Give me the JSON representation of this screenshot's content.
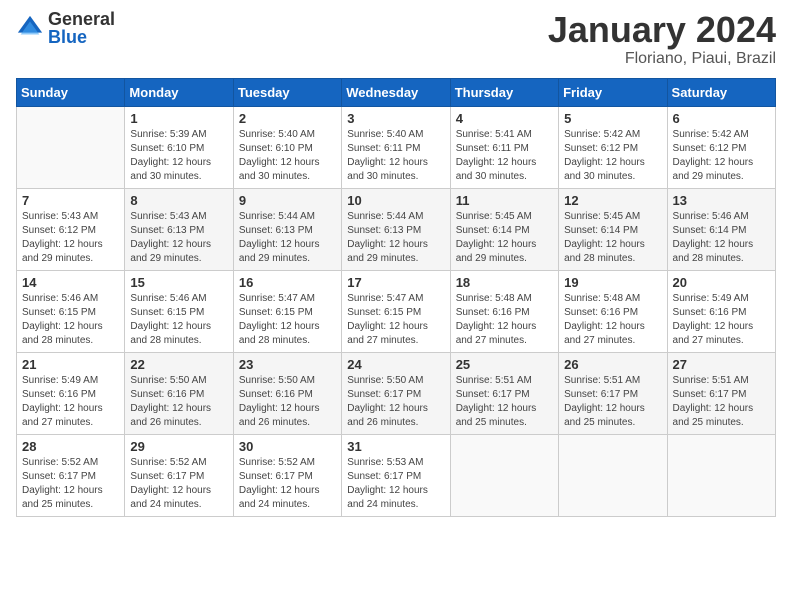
{
  "logo": {
    "general": "General",
    "blue": "Blue"
  },
  "title": {
    "month": "January 2024",
    "location": "Floriano, Piaui, Brazil"
  },
  "weekdays": [
    "Sunday",
    "Monday",
    "Tuesday",
    "Wednesday",
    "Thursday",
    "Friday",
    "Saturday"
  ],
  "weeks": [
    [
      {
        "day": "",
        "sunrise": "",
        "sunset": "",
        "daylight": ""
      },
      {
        "day": "1",
        "sunrise": "Sunrise: 5:39 AM",
        "sunset": "Sunset: 6:10 PM",
        "daylight": "Daylight: 12 hours and 30 minutes."
      },
      {
        "day": "2",
        "sunrise": "Sunrise: 5:40 AM",
        "sunset": "Sunset: 6:10 PM",
        "daylight": "Daylight: 12 hours and 30 minutes."
      },
      {
        "day": "3",
        "sunrise": "Sunrise: 5:40 AM",
        "sunset": "Sunset: 6:11 PM",
        "daylight": "Daylight: 12 hours and 30 minutes."
      },
      {
        "day": "4",
        "sunrise": "Sunrise: 5:41 AM",
        "sunset": "Sunset: 6:11 PM",
        "daylight": "Daylight: 12 hours and 30 minutes."
      },
      {
        "day": "5",
        "sunrise": "Sunrise: 5:42 AM",
        "sunset": "Sunset: 6:12 PM",
        "daylight": "Daylight: 12 hours and 30 minutes."
      },
      {
        "day": "6",
        "sunrise": "Sunrise: 5:42 AM",
        "sunset": "Sunset: 6:12 PM",
        "daylight": "Daylight: 12 hours and 29 minutes."
      }
    ],
    [
      {
        "day": "7",
        "sunrise": "Sunrise: 5:43 AM",
        "sunset": "Sunset: 6:12 PM",
        "daylight": "Daylight: 12 hours and 29 minutes."
      },
      {
        "day": "8",
        "sunrise": "Sunrise: 5:43 AM",
        "sunset": "Sunset: 6:13 PM",
        "daylight": "Daylight: 12 hours and 29 minutes."
      },
      {
        "day": "9",
        "sunrise": "Sunrise: 5:44 AM",
        "sunset": "Sunset: 6:13 PM",
        "daylight": "Daylight: 12 hours and 29 minutes."
      },
      {
        "day": "10",
        "sunrise": "Sunrise: 5:44 AM",
        "sunset": "Sunset: 6:13 PM",
        "daylight": "Daylight: 12 hours and 29 minutes."
      },
      {
        "day": "11",
        "sunrise": "Sunrise: 5:45 AM",
        "sunset": "Sunset: 6:14 PM",
        "daylight": "Daylight: 12 hours and 29 minutes."
      },
      {
        "day": "12",
        "sunrise": "Sunrise: 5:45 AM",
        "sunset": "Sunset: 6:14 PM",
        "daylight": "Daylight: 12 hours and 28 minutes."
      },
      {
        "day": "13",
        "sunrise": "Sunrise: 5:46 AM",
        "sunset": "Sunset: 6:14 PM",
        "daylight": "Daylight: 12 hours and 28 minutes."
      }
    ],
    [
      {
        "day": "14",
        "sunrise": "Sunrise: 5:46 AM",
        "sunset": "Sunset: 6:15 PM",
        "daylight": "Daylight: 12 hours and 28 minutes."
      },
      {
        "day": "15",
        "sunrise": "Sunrise: 5:46 AM",
        "sunset": "Sunset: 6:15 PM",
        "daylight": "Daylight: 12 hours and 28 minutes."
      },
      {
        "day": "16",
        "sunrise": "Sunrise: 5:47 AM",
        "sunset": "Sunset: 6:15 PM",
        "daylight": "Daylight: 12 hours and 28 minutes."
      },
      {
        "day": "17",
        "sunrise": "Sunrise: 5:47 AM",
        "sunset": "Sunset: 6:15 PM",
        "daylight": "Daylight: 12 hours and 27 minutes."
      },
      {
        "day": "18",
        "sunrise": "Sunrise: 5:48 AM",
        "sunset": "Sunset: 6:16 PM",
        "daylight": "Daylight: 12 hours and 27 minutes."
      },
      {
        "day": "19",
        "sunrise": "Sunrise: 5:48 AM",
        "sunset": "Sunset: 6:16 PM",
        "daylight": "Daylight: 12 hours and 27 minutes."
      },
      {
        "day": "20",
        "sunrise": "Sunrise: 5:49 AM",
        "sunset": "Sunset: 6:16 PM",
        "daylight": "Daylight: 12 hours and 27 minutes."
      }
    ],
    [
      {
        "day": "21",
        "sunrise": "Sunrise: 5:49 AM",
        "sunset": "Sunset: 6:16 PM",
        "daylight": "Daylight: 12 hours and 27 minutes."
      },
      {
        "day": "22",
        "sunrise": "Sunrise: 5:50 AM",
        "sunset": "Sunset: 6:16 PM",
        "daylight": "Daylight: 12 hours and 26 minutes."
      },
      {
        "day": "23",
        "sunrise": "Sunrise: 5:50 AM",
        "sunset": "Sunset: 6:16 PM",
        "daylight": "Daylight: 12 hours and 26 minutes."
      },
      {
        "day": "24",
        "sunrise": "Sunrise: 5:50 AM",
        "sunset": "Sunset: 6:17 PM",
        "daylight": "Daylight: 12 hours and 26 minutes."
      },
      {
        "day": "25",
        "sunrise": "Sunrise: 5:51 AM",
        "sunset": "Sunset: 6:17 PM",
        "daylight": "Daylight: 12 hours and 25 minutes."
      },
      {
        "day": "26",
        "sunrise": "Sunrise: 5:51 AM",
        "sunset": "Sunset: 6:17 PM",
        "daylight": "Daylight: 12 hours and 25 minutes."
      },
      {
        "day": "27",
        "sunrise": "Sunrise: 5:51 AM",
        "sunset": "Sunset: 6:17 PM",
        "daylight": "Daylight: 12 hours and 25 minutes."
      }
    ],
    [
      {
        "day": "28",
        "sunrise": "Sunrise: 5:52 AM",
        "sunset": "Sunset: 6:17 PM",
        "daylight": "Daylight: 12 hours and 25 minutes."
      },
      {
        "day": "29",
        "sunrise": "Sunrise: 5:52 AM",
        "sunset": "Sunset: 6:17 PM",
        "daylight": "Daylight: 12 hours and 24 minutes."
      },
      {
        "day": "30",
        "sunrise": "Sunrise: 5:52 AM",
        "sunset": "Sunset: 6:17 PM",
        "daylight": "Daylight: 12 hours and 24 minutes."
      },
      {
        "day": "31",
        "sunrise": "Sunrise: 5:53 AM",
        "sunset": "Sunset: 6:17 PM",
        "daylight": "Daylight: 12 hours and 24 minutes."
      },
      {
        "day": "",
        "sunrise": "",
        "sunset": "",
        "daylight": ""
      },
      {
        "day": "",
        "sunrise": "",
        "sunset": "",
        "daylight": ""
      },
      {
        "day": "",
        "sunrise": "",
        "sunset": "",
        "daylight": ""
      }
    ]
  ]
}
